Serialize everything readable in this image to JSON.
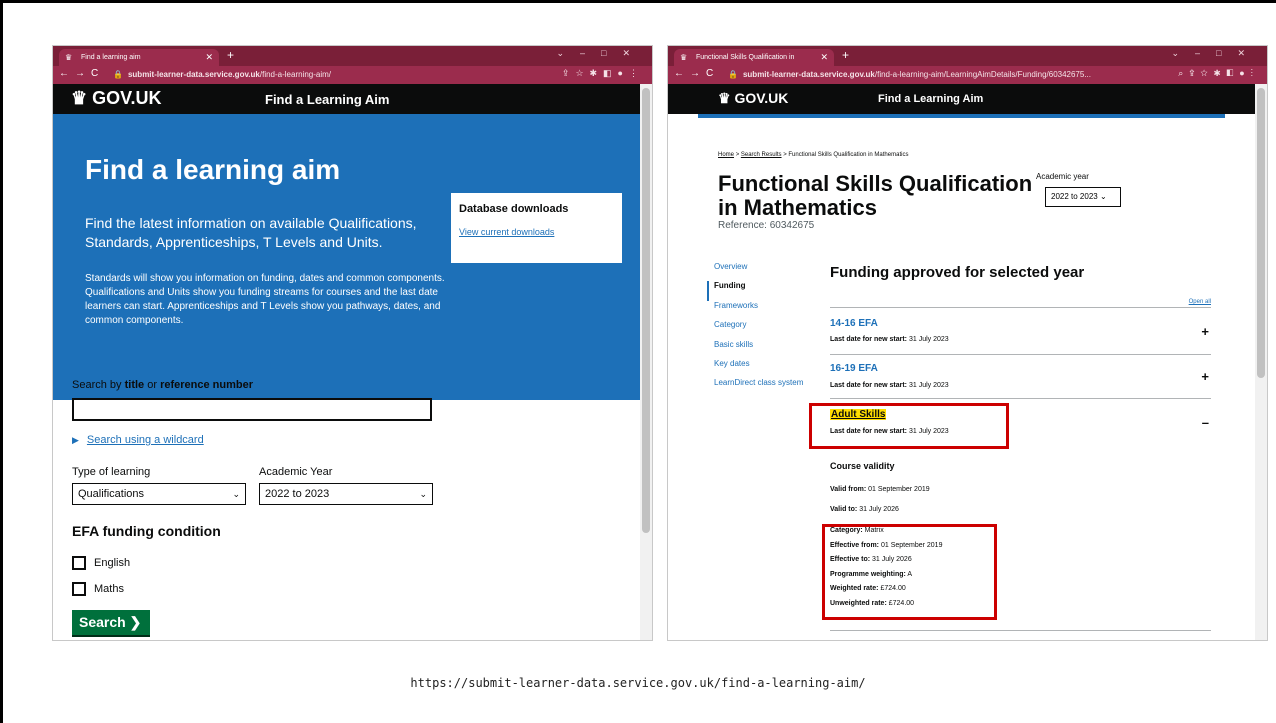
{
  "caption": "https://submit-learner-data.service.gov.uk/find-a-learning-aim/",
  "left_window": {
    "tab_title": "Find a learning aim",
    "address_domain": "submit-learner-data.service.gov.uk",
    "address_path": "/find-a-learning-aim/",
    "gov_logo": "GOV.UK",
    "service_name": "Find a Learning Aim",
    "heading": "Find a learning aim",
    "lead": "Find the latest information on available Qualifications, Standards, Apprenticeships, T Levels and Units.",
    "body": "Standards will show you information on funding, dates and common components. Qualifications and Units show you funding streams for courses and the last date learners can start. Apprenticeships and T Levels show you pathways, dates, and common components.",
    "downloads_title": "Database downloads",
    "downloads_link": "View current downloads",
    "search_label_pre": "Search by ",
    "search_label_b1": "title",
    "search_label_mid": " or ",
    "search_label_b2": "reference number",
    "wildcard_link": "Search using a wildcard",
    "type_label": "Type of learning",
    "type_value": "Qualifications",
    "year_label": "Academic Year",
    "year_value": "2022 to 2023",
    "efa_heading": "EFA funding condition",
    "checkbox_english": "English",
    "checkbox_maths": "Maths",
    "search_button": "Search"
  },
  "right_window": {
    "tab_title": "Functional Skills Qualification in",
    "address_domain": "submit-learner-data.service.gov.uk",
    "address_path": "/find-a-learning-aim/LearningAimDetails/Funding/60342675...",
    "gov_logo": "GOV.UK",
    "service_name": "Find a Learning Aim",
    "breadcrumb_home": "Home",
    "breadcrumb_results": "Search Results",
    "breadcrumb_current": "Functional Skills Qualification in Mathematics",
    "title": "Functional Skills Qualification in Mathematics",
    "reference": "Reference: 60342675",
    "academic_year_label": "Academic year",
    "academic_year_value": "2022 to 2023",
    "side_nav": [
      "Overview",
      "Funding",
      "Frameworks",
      "Category",
      "Basic skills",
      "Key dates",
      "LearnDirect class system"
    ],
    "funding_heading": "Funding approved for selected year",
    "open_all": "Open all",
    "last_date_label": "Last date for new start:",
    "accordion": [
      {
        "title": "14-16 EFA",
        "last_date": "31 July 2023",
        "icon": "+"
      },
      {
        "title": "16-19 EFA",
        "last_date": "31 July 2023",
        "icon": "+"
      },
      {
        "title": "Adult Skills",
        "last_date": "31 July 2023",
        "icon": "–"
      }
    ],
    "course_validity_heading": "Course validity",
    "valid_from_label": "Valid from:",
    "valid_from": "01 September 2019",
    "valid_to_label": "Valid to:",
    "valid_to": "31 July 2026",
    "funding_details": [
      {
        "label": "Category:",
        "value": "Matrix"
      },
      {
        "label": "Effective from:",
        "value": "01 September 2019"
      },
      {
        "label": "Effective to:",
        "value": "31 July 2026"
      },
      {
        "label": "Programme weighting:",
        "value": "A"
      },
      {
        "label": "Weighted rate:",
        "value": "£724.00"
      },
      {
        "label": "Unweighted rate:",
        "value": "£724.00"
      }
    ]
  },
  "colors": {
    "browser_frame": "#7a1f38",
    "gov_black": "#0b0c0c",
    "gov_blue": "#1d70b8",
    "gov_green": "#00703c",
    "highlight_yellow": "#ffdd00",
    "annotation_red": "#cc0000"
  }
}
